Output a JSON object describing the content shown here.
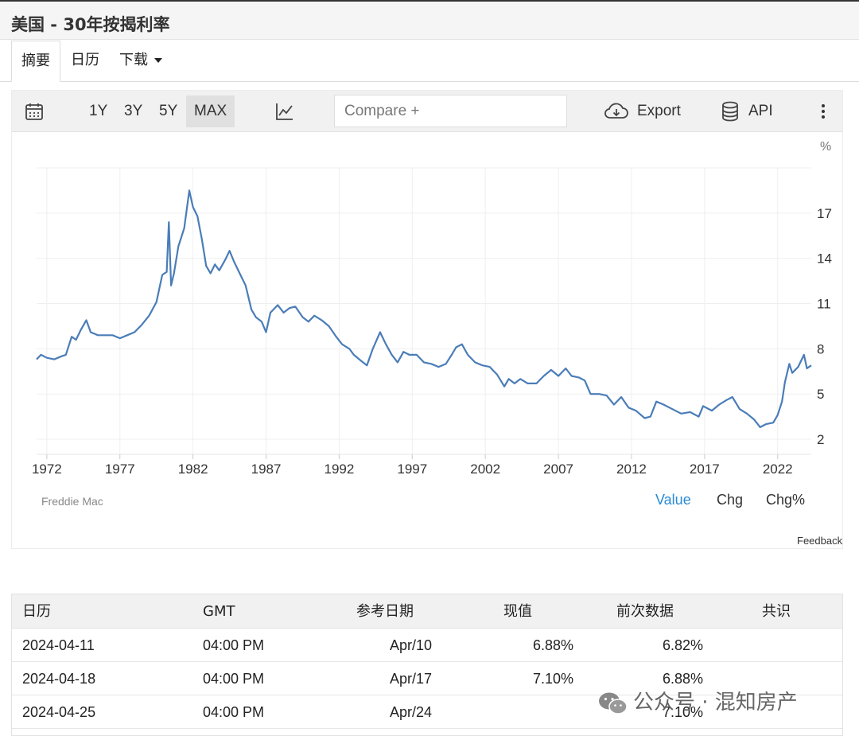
{
  "page_title": "美国 - 30年按揭利率",
  "tabs": [
    {
      "label": "摘要",
      "active": true
    },
    {
      "label": "日历"
    },
    {
      "label": "下载"
    }
  ],
  "toolbar": {
    "calendar_icon": "calendar-icon",
    "ranges": [
      "1Y",
      "3Y",
      "5Y",
      "MAX"
    ],
    "selected_range": "MAX",
    "chart_type_icon": "line-chart-icon",
    "compare_placeholder": "Compare +",
    "export_label": "Export",
    "export_icon": "cloud-download-icon",
    "api_label": "API",
    "api_icon": "database-icon",
    "more_icon": "more-vertical-icon"
  },
  "chart_data": {
    "type": "line",
    "unit_label": "%",
    "line_color": "#4a7db8",
    "x_ticks": [
      "1972",
      "1977",
      "1982",
      "1987",
      "1992",
      "1997",
      "2002",
      "2007",
      "2012",
      "2017",
      "2022"
    ],
    "y_ticks": [
      2,
      5,
      8,
      11,
      14,
      17
    ],
    "ylim": [
      1.0,
      20.0
    ],
    "xlim": [
      1971.3,
      2024.3
    ],
    "series": [
      {
        "x": [
          1971.3,
          1971.6,
          1972.0,
          1972.5,
          1973.0,
          1973.3,
          1973.7,
          1974.0,
          1974.3,
          1974.7,
          1975.0,
          1975.5,
          1976.0,
          1976.5,
          1977.0,
          1977.5,
          1978.0,
          1978.5,
          1979.0,
          1979.5,
          1979.9,
          1980.2,
          1980.35,
          1980.5,
          1980.7,
          1981.0,
          1981.4,
          1981.75,
          1982.0,
          1982.3,
          1982.6,
          1982.9,
          1983.2,
          1983.5,
          1983.8,
          1984.2,
          1984.5,
          1984.8,
          1985.2,
          1985.6,
          1986.0,
          1986.3,
          1986.7,
          1987.0,
          1987.3,
          1987.8,
          1988.2,
          1988.6,
          1989.0,
          1989.5,
          1989.9,
          1990.3,
          1990.8,
          1991.3,
          1991.8,
          1992.2,
          1992.7,
          1993.0,
          1993.5,
          1993.9,
          1994.3,
          1994.8,
          1995.2,
          1995.6,
          1996.0,
          1996.4,
          1996.8,
          1997.3,
          1997.8,
          1998.3,
          1998.8,
          1999.3,
          1999.7,
          2000.0,
          2000.4,
          2000.8,
          2001.3,
          2001.8,
          2002.3,
          2002.8,
          2003.3,
          2003.6,
          2004.0,
          2004.4,
          2004.9,
          2005.5,
          2006.0,
          2006.5,
          2007.0,
          2007.5,
          2007.9,
          2008.4,
          2008.8,
          2009.2,
          2009.8,
          2010.3,
          2010.8,
          2011.3,
          2011.8,
          2012.3,
          2012.9,
          2013.3,
          2013.7,
          2014.2,
          2014.8,
          2015.4,
          2016.0,
          2016.6,
          2016.9,
          2017.5,
          2018.0,
          2018.5,
          2018.9,
          2019.4,
          2019.9,
          2020.4,
          2020.8,
          2021.2,
          2021.7,
          2022.0,
          2022.3,
          2022.5,
          2022.8,
          2023.0,
          2023.4,
          2023.8,
          2024.0,
          2024.3
        ],
        "y": [
          7.3,
          7.6,
          7.4,
          7.3,
          7.5,
          7.6,
          8.8,
          8.6,
          9.2,
          9.9,
          9.1,
          8.9,
          8.9,
          8.9,
          8.7,
          8.9,
          9.1,
          9.6,
          10.2,
          11.1,
          12.9,
          13.1,
          16.4,
          12.2,
          13.0,
          14.8,
          16.0,
          18.5,
          17.4,
          16.8,
          15.3,
          13.5,
          13.0,
          13.6,
          13.2,
          13.9,
          14.5,
          13.8,
          13.0,
          12.2,
          10.6,
          10.1,
          9.8,
          9.1,
          10.4,
          10.9,
          10.4,
          10.7,
          10.8,
          10.1,
          9.8,
          10.2,
          9.9,
          9.5,
          8.8,
          8.3,
          8.0,
          7.6,
          7.2,
          6.9,
          8.0,
          9.1,
          8.3,
          7.6,
          7.1,
          7.8,
          7.6,
          7.6,
          7.1,
          7.0,
          6.8,
          7.0,
          7.6,
          8.1,
          8.3,
          7.6,
          7.1,
          6.9,
          6.8,
          6.3,
          5.5,
          6.0,
          5.7,
          6.0,
          5.7,
          5.7,
          6.2,
          6.6,
          6.2,
          6.7,
          6.2,
          6.1,
          5.9,
          5.0,
          5.0,
          4.9,
          4.3,
          4.8,
          4.1,
          3.9,
          3.4,
          3.5,
          4.5,
          4.3,
          4.0,
          3.7,
          3.8,
          3.5,
          4.2,
          3.9,
          4.3,
          4.6,
          4.8,
          4.0,
          3.7,
          3.3,
          2.8,
          3.0,
          3.1,
          3.6,
          4.5,
          5.8,
          7.0,
          6.4,
          6.8,
          7.6,
          6.7,
          6.9
        ]
      }
    ],
    "source": "Freddie Mac",
    "view_options": [
      "Value",
      "Chg",
      "Chg%"
    ],
    "selected_view": "Value"
  },
  "feedback_label": "Feedback",
  "table": {
    "headers": [
      "日历",
      "GMT",
      "参考日期",
      "现值",
      "前次数据",
      "共识"
    ],
    "rows": [
      [
        "2024-04-11",
        "04:00 PM",
        "Apr/10",
        "6.88%",
        "6.82%",
        ""
      ],
      [
        "2024-04-18",
        "04:00 PM",
        "Apr/17",
        "7.10%",
        "6.88%",
        ""
      ],
      [
        "2024-04-25",
        "04:00 PM",
        "Apr/24",
        "",
        "7.10%",
        ""
      ]
    ]
  },
  "watermark": "公众号 · 混知房产",
  "watermark_icon": "wechat-icon"
}
